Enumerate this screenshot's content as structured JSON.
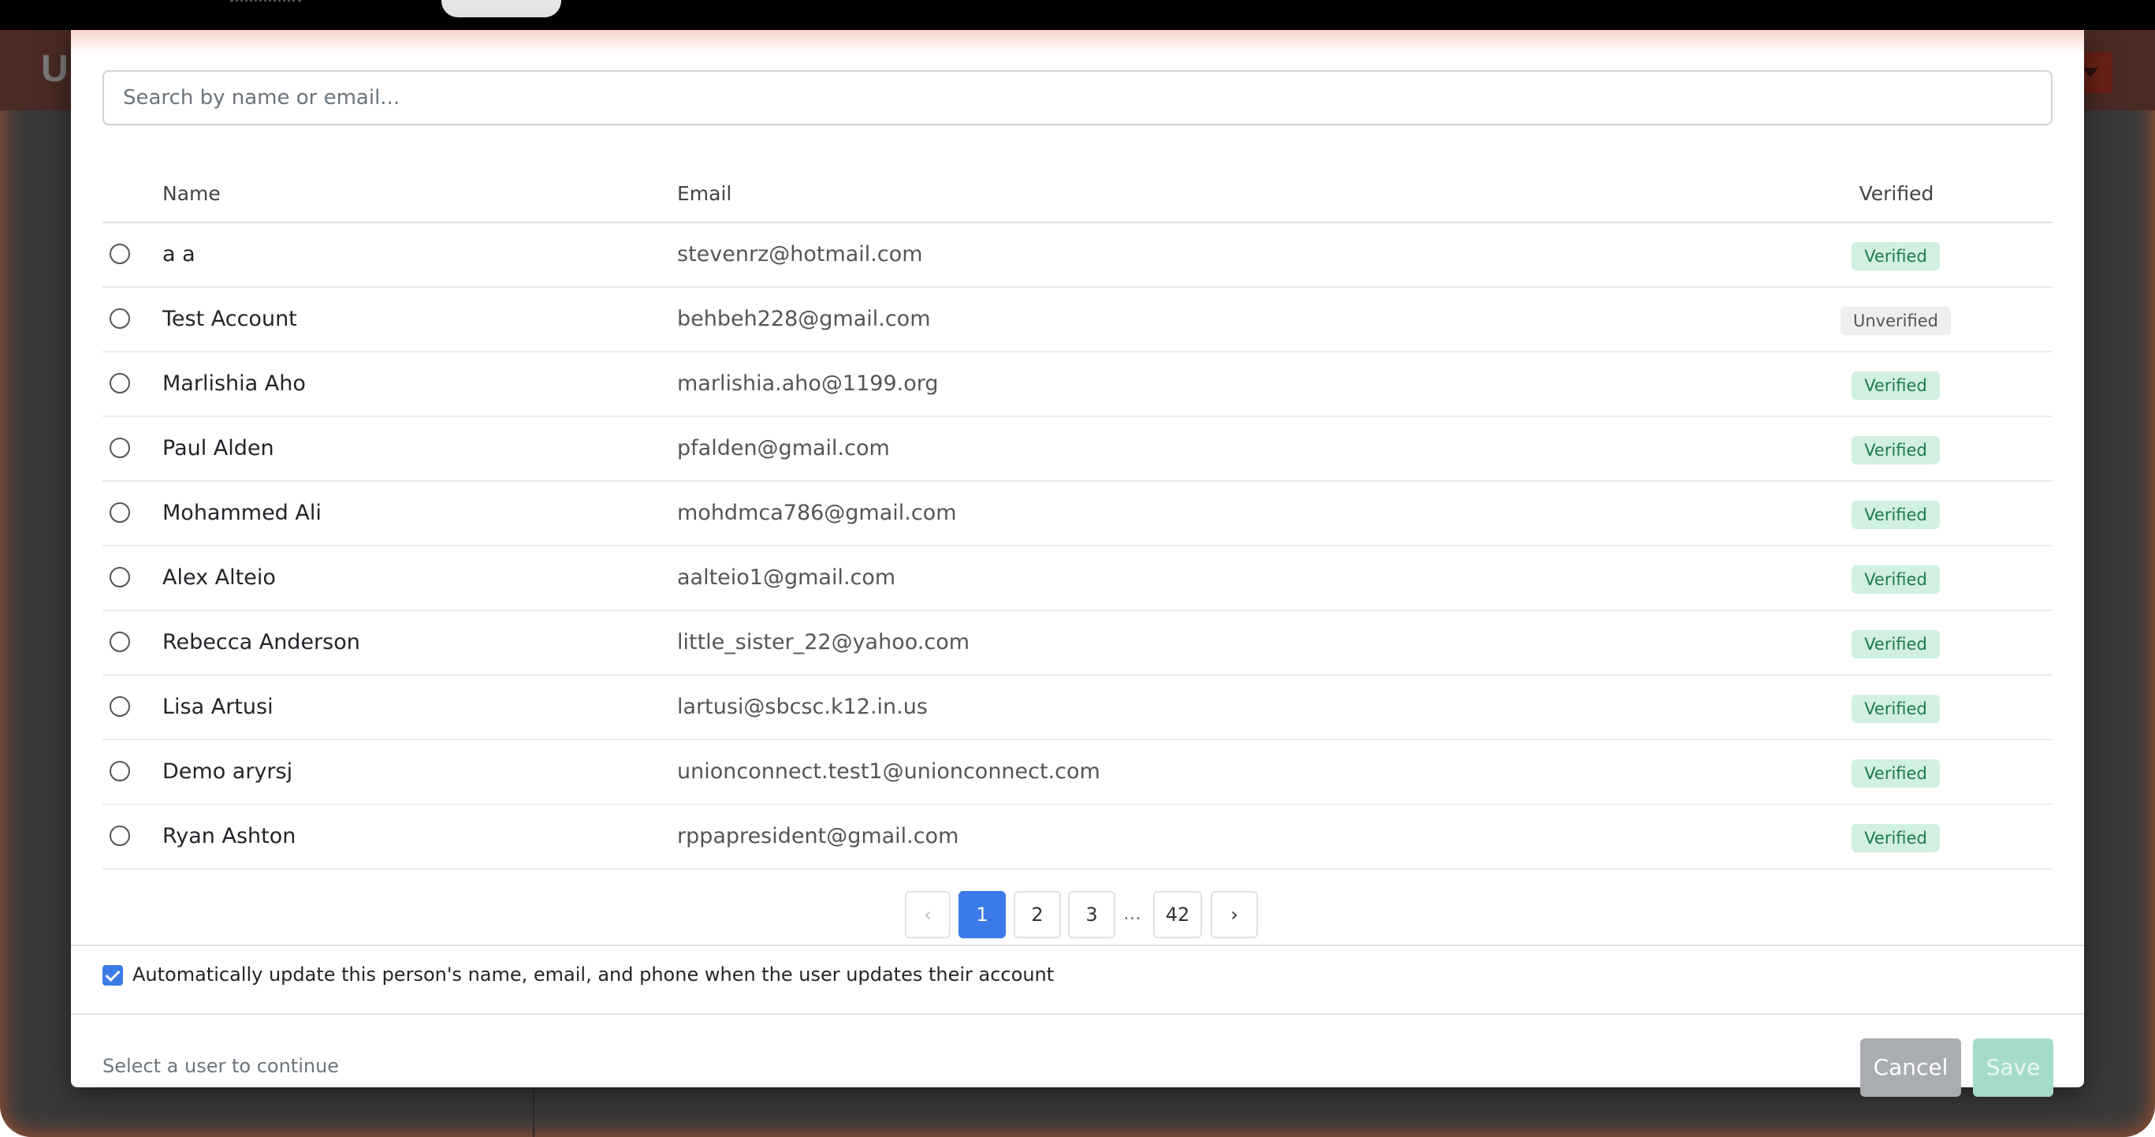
{
  "modal": {
    "search": {
      "placeholder": "Search by name or email..."
    },
    "table": {
      "headers": {
        "name": "Name",
        "email": "Email",
        "verified": "Verified"
      },
      "rows": [
        {
          "name": "a a",
          "email": "stevenrz@hotmail.com",
          "status": "Verified"
        },
        {
          "name": "Test Account",
          "email": "behbeh228@gmail.com",
          "status": "Unverified"
        },
        {
          "name": "Marlishia Aho",
          "email": "marlishia.aho@1199.org",
          "status": "Verified"
        },
        {
          "name": "Paul Alden",
          "email": "pfalden@gmail.com",
          "status": "Verified"
        },
        {
          "name": "Mohammed Ali",
          "email": "mohdmca786@gmail.com",
          "status": "Verified"
        },
        {
          "name": "Alex Alteio",
          "email": "aalteio1@gmail.com",
          "status": "Verified"
        },
        {
          "name": "Rebecca Anderson",
          "email": "little_sister_22@yahoo.com",
          "status": "Verified"
        },
        {
          "name": "Lisa Artusi",
          "email": "lartusi@sbcsc.k12.in.us",
          "status": "Verified"
        },
        {
          "name": "Demo aryrsj",
          "email": "unionconnect.test1@unionconnect.com",
          "status": "Verified"
        },
        {
          "name": "Ryan Ashton",
          "email": "rppapresident@gmail.com",
          "status": "Verified"
        }
      ]
    },
    "pagination": {
      "prev": "‹",
      "pages": [
        "1",
        "2",
        "3"
      ],
      "ellipsis": "...",
      "last": "42",
      "next": "›",
      "current": "1"
    },
    "auto_update": {
      "checked": true,
      "label": "Automatically update this person's name, email, and phone when the user updates their account"
    },
    "footer": {
      "hint": "Select a user to continue",
      "cancel_label": "Cancel",
      "save_label": "Save"
    }
  },
  "background": {
    "header_letter": "U"
  },
  "colors": {
    "primary": "#3b7be8",
    "verified_bg": "#d1f0e0",
    "verified_text": "#1e7a4a",
    "unverified_bg": "#eceef0",
    "cancel_bg": "#a9acb0",
    "save_bg": "#a5dcc8"
  }
}
